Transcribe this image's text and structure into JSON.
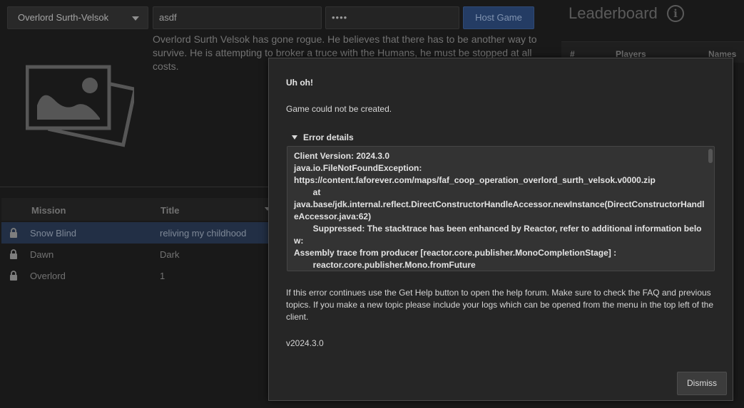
{
  "toolbar": {
    "mission_select": "Overlord Surth-Velsok",
    "game_title_value": "asdf",
    "password_value": "••••",
    "host_button": "Host Game"
  },
  "mission_description": "Overlord Surth Velsok has gone rogue. He believes that there has to be another way to survive. He is attempting to broker a truce with the Humans, he must be stopped at all costs.",
  "leaderboard": {
    "title": "Leaderboard",
    "columns": [
      "#",
      "Players",
      "Names"
    ]
  },
  "missions_table": {
    "columns": [
      "Mission",
      "Title"
    ],
    "rows": [
      {
        "mission": "Snow Blind",
        "title": "reliving my childhood",
        "selected": true
      },
      {
        "mission": "Dawn",
        "title": "Dark",
        "selected": false
      },
      {
        "mission": "Overlord",
        "title": "1",
        "selected": false
      }
    ]
  },
  "dialog": {
    "title": "Uh oh!",
    "message": "Game could not be created.",
    "details_label": "Error details",
    "trace_lines": [
      "Client Version: 2024.3.0",
      "java.io.FileNotFoundException:",
      "https://content.faforever.com/maps/faf_coop_operation_overlord_surth_velsok.v0000.zip",
      "        at",
      "java.base/jdk.internal.reflect.DirectConstructorHandleAccessor.newInstance(DirectConstructorHandleAccessor.java:62)",
      "        Suppressed: The stacktrace has been enhanced by Reactor, refer to additional information below:",
      "Assembly trace from producer [reactor.core.publisher.MonoCompletionStage] :",
      "        reactor.core.publisher.Mono.fromFuture"
    ],
    "help_text": "If this error continues use the Get Help button to open the help forum. Make sure to check the FAQ and previous topics. If you make a new topic please include your logs which can be opened from the menu in the top left of the client.",
    "version": "v2024.3.0",
    "dismiss_label": "Dismiss"
  }
}
